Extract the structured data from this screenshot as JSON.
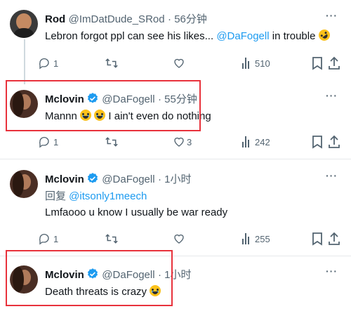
{
  "tweets": [
    {
      "name": "Rod",
      "handle": "@ImDatDude_SRod",
      "time": "· 56分钟",
      "text_before": "Lebron forgot ppl can see his likes... ",
      "mention": "@DaFogell",
      "text_after": " in trouble",
      "emoji": "rolling-on-floor-laughing",
      "reply_count": "1",
      "retweet_count": "",
      "like_count": "",
      "views": "510",
      "verified": false
    },
    {
      "name": "Mclovin",
      "handle": "@DaFogell",
      "time": "· 55分钟",
      "text_before": "Mannn ",
      "text_after": " I ain't even do nothing",
      "emoji": "loudly-crying-face",
      "reply_count": "1",
      "retweet_count": "",
      "like_count": "3",
      "views": "242",
      "verified": true,
      "highlighted": true
    },
    {
      "name": "Mclovin",
      "handle": "@DaFogell",
      "time": "· 1小时",
      "reply_prefix": "回复 ",
      "reply_to": "@itsonly1meech",
      "text": "Lmfaooo u know I usually be war ready",
      "reply_count": "1",
      "retweet_count": "",
      "like_count": "",
      "views": "255",
      "verified": true
    },
    {
      "name": "Mclovin",
      "handle": "@DaFogell",
      "time": "· 1小时",
      "text_before": "Death threats is crazy ",
      "emoji": "loudly-crying-face",
      "verified": true,
      "highlighted": true
    }
  ],
  "colors": {
    "accent": "#1d9bf0",
    "muted": "#536471",
    "highlight": "#e8323c",
    "verified": "#1d9bf0"
  },
  "icons": [
    "more-icon",
    "reply-icon",
    "retweet-icon",
    "like-icon",
    "views-icon",
    "bookmark-icon",
    "share-icon",
    "verified-icon"
  ]
}
